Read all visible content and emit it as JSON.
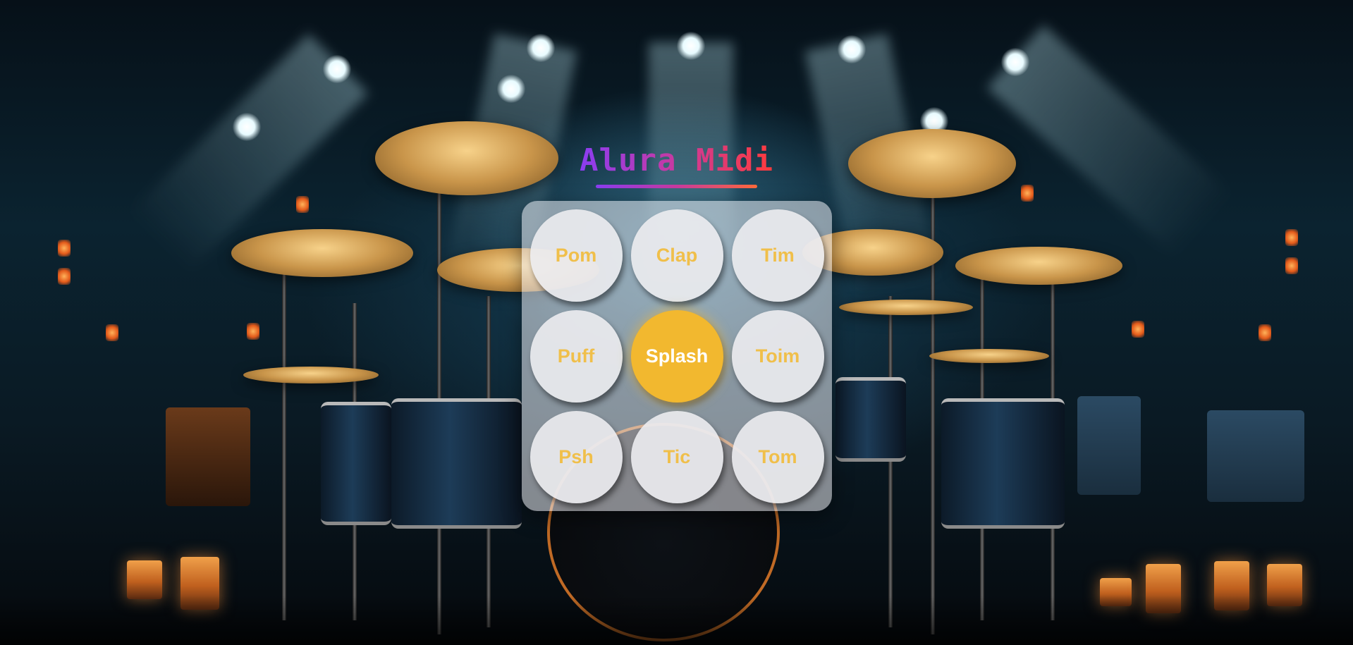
{
  "app": {
    "title": "Alura Midi"
  },
  "pads": [
    {
      "label": "Pom",
      "active": false
    },
    {
      "label": "Clap",
      "active": false
    },
    {
      "label": "Tim",
      "active": false
    },
    {
      "label": "Puff",
      "active": false
    },
    {
      "label": "Splash",
      "active": true
    },
    {
      "label": "Toim",
      "active": false
    },
    {
      "label": "Psh",
      "active": false
    },
    {
      "label": "Tic",
      "active": false
    },
    {
      "label": "Tom",
      "active": false
    }
  ],
  "colors": {
    "pad_text": "#f0bf4a",
    "pad_active_bg": "#f2b82f",
    "pad_active_text": "#ffffff",
    "title_gradient_start": "#8a3df2",
    "title_gradient_end": "#ff3b3b"
  }
}
